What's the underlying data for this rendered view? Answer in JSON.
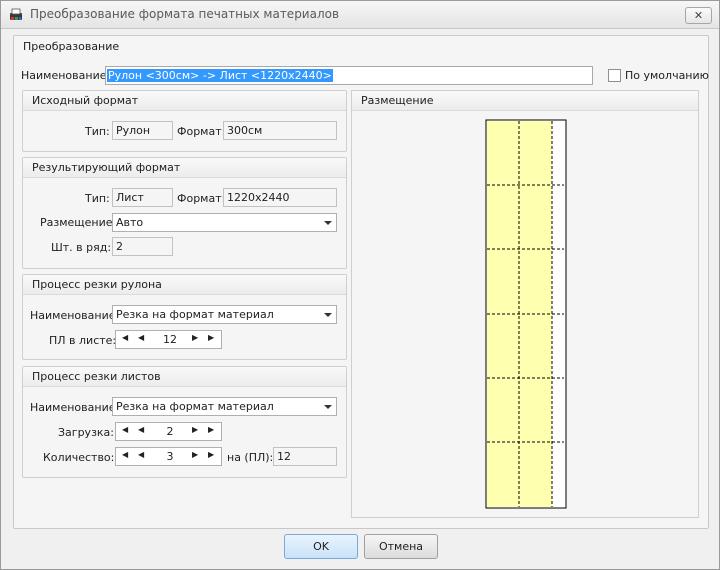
{
  "window": {
    "title": "Преобразование формата печатных материалов",
    "close_glyph": "✕"
  },
  "conversion": {
    "group_title": "Преобразование",
    "name_label": "Наименование:",
    "name_value": "Рулон <300см> -> Лист <1220x2440>",
    "default_label": "По умолчанию",
    "default_checked": false
  },
  "source_format": {
    "title": "Исходный формат",
    "type_label": "Тип:",
    "type_value": "Рулон",
    "format_label": "Формат:",
    "format_value": "300см"
  },
  "result_format": {
    "title": "Результирующий формат",
    "type_label": "Тип:",
    "type_value": "Лист",
    "format_label": "Формат:",
    "format_value": "1220x2440",
    "placement_label": "Размещение:",
    "placement_value": "Авто",
    "per_row_label": "Шт. в ряд:",
    "per_row_value": "2"
  },
  "roll_cutting": {
    "title": "Процесс резки рулона",
    "name_label": "Наименование:",
    "name_value": "Резка на формат материал",
    "pl_label": "ПЛ в листе:",
    "pl_value": "12"
  },
  "sheet_cutting": {
    "title": "Процесс резки листов",
    "name_label": "Наименование:",
    "name_value": "Резка на формат материал",
    "load_label": "Загрузка:",
    "load_value": "2",
    "qty_label": "Количество:",
    "qty_value": "3",
    "per_pl_label": "на (ПЛ):",
    "per_pl_value": "12"
  },
  "preview": {
    "title": "Размещение",
    "columns": 2,
    "rows": 6,
    "fill_color": "#ffffb0"
  },
  "buttons": {
    "ok": "OK",
    "cancel": "Отмена"
  },
  "colors": {
    "selection": "#3399ff",
    "ok_button": "#c9e2f8"
  }
}
